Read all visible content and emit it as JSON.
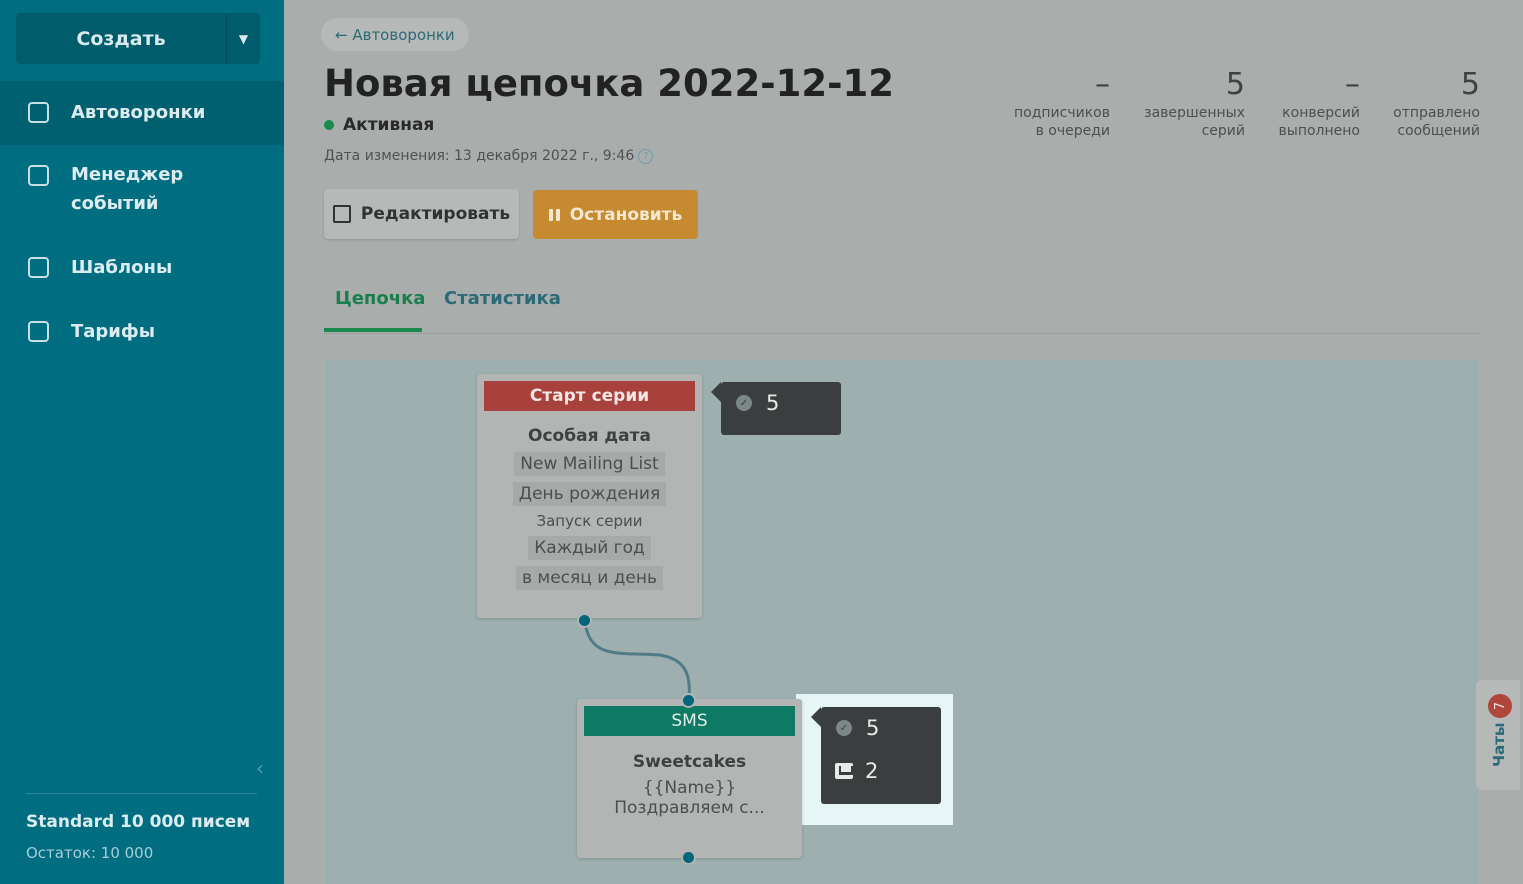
{
  "sidebar": {
    "create_label": "Создать",
    "items": [
      {
        "label": "Автоворонки",
        "icon": "funnel-icon"
      },
      {
        "label_line1": "Менеджер",
        "label_line2": "событий",
        "icon": "code-bracket-icon"
      },
      {
        "label": "Шаблоны",
        "icon": "template-icon"
      },
      {
        "label": "Тарифы",
        "icon": "wallet-icon"
      }
    ],
    "plan_name": "Standard 10 000 писем",
    "plan_rest": "Остаток: 10 000"
  },
  "header": {
    "back_label": "← Автоворонки",
    "title": "Новая цепочка 2022-12-12",
    "status": "Активная",
    "modified": "Дата изменения: 13 декабря 2022 г., 9:46",
    "stats": [
      {
        "value": "–",
        "line1": "подписчиков",
        "line2": "в очереди"
      },
      {
        "value": "5",
        "line1": "завершенных",
        "line2": "серий"
      },
      {
        "value": "–",
        "line1": "конверсий",
        "line2": "выполнено"
      },
      {
        "value": "5",
        "line1": "отправлено",
        "line2": "сообщений"
      }
    ],
    "edit_label": "Редактировать",
    "stop_label": "Остановить"
  },
  "tabs": [
    {
      "label": "Цепочка",
      "active": true
    },
    {
      "label": "Статистика",
      "active": false
    }
  ],
  "flow": {
    "start_node": {
      "header": "Старт серии",
      "header_color": "#a8413b",
      "subtitle": "Особая дата",
      "chips": [
        "New Mailing List",
        "День рождения"
      ],
      "launch_label": "Запуск серии",
      "chips2": [
        "Каждый год",
        "в месяц и день"
      ],
      "tooltip_completed": "5"
    },
    "sms_node": {
      "header": "SMS",
      "header_color": "#0f7a63",
      "title": "Sweetcakes",
      "line1": "{{Name}}",
      "line2": "Поздравляем с...",
      "tooltip_sent": "5",
      "tooltip_delivered": "2"
    }
  },
  "chats": {
    "label": "Чаты",
    "badge": "7"
  }
}
